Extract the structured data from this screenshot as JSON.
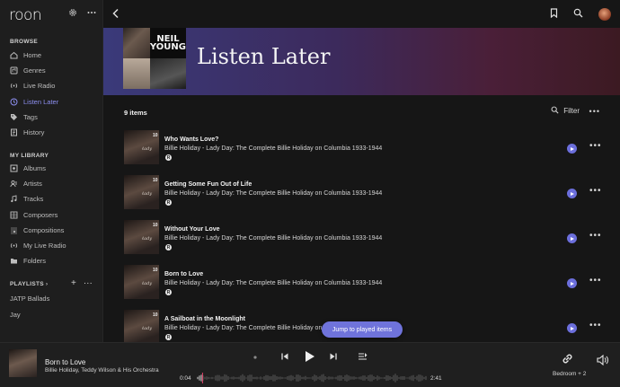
{
  "app": {
    "logo": "roon"
  },
  "sidebar": {
    "browse_title": "BROWSE",
    "browse_items": [
      {
        "label": "Home",
        "icon": "home-icon"
      },
      {
        "label": "Genres",
        "icon": "genres-icon"
      },
      {
        "label": "Live Radio",
        "icon": "radio-icon"
      },
      {
        "label": "Listen Later",
        "icon": "bookmark-icon",
        "active": true
      },
      {
        "label": "Tags",
        "icon": "tag-icon"
      },
      {
        "label": "History",
        "icon": "history-icon"
      }
    ],
    "library_title": "MY LIBRARY",
    "library_items": [
      {
        "label": "Albums",
        "icon": "album-icon"
      },
      {
        "label": "Artists",
        "icon": "artist-icon"
      },
      {
        "label": "Tracks",
        "icon": "track-icon"
      },
      {
        "label": "Composers",
        "icon": "composer-icon"
      },
      {
        "label": "Compositions",
        "icon": "composition-icon"
      },
      {
        "label": "My Live Radio",
        "icon": "radio-icon"
      },
      {
        "label": "Folders",
        "icon": "folder-icon"
      }
    ],
    "playlists_title": "PLAYLISTS",
    "playlists": [
      "JATP Ballads",
      "Jay"
    ]
  },
  "header": {
    "title": "Listen Later",
    "hero_art_text": "NEIL YOUNG"
  },
  "list": {
    "count": "9 items",
    "filter_label": "Filter",
    "tracks": [
      {
        "num": "10",
        "title": "Who Wants Love?",
        "subtitle": "Billie Holiday - Lady Day: The Complete Billie Holiday on Columbia 1933-1944",
        "badge": "R"
      },
      {
        "num": "10",
        "title": "Getting Some Fun Out of Life",
        "subtitle": "Billie Holiday - Lady Day: The Complete Billie Holiday on Columbia 1933-1944",
        "badge": "R"
      },
      {
        "num": "10",
        "title": "Without Your Love",
        "subtitle": "Billie Holiday - Lady Day: The Complete Billie Holiday on Columbia 1933-1944",
        "badge": "R"
      },
      {
        "num": "10",
        "title": "Born to Love",
        "subtitle": "Billie Holiday - Lady Day: The Complete Billie Holiday on Columbia 1933-1944",
        "badge": "R"
      },
      {
        "num": "10",
        "title": "A Sailboat in the Moonlight",
        "subtitle": "Billie Holiday - Lady Day: The Complete Billie Holiday on Columbia 1933-1944",
        "badge": "R"
      }
    ],
    "jump_label": "Jump to played items"
  },
  "player": {
    "title": "Born to Love",
    "artist": "Billie Holiday, Teddy Wilson & His Orchestra",
    "elapsed": "0:04",
    "duration": "2:41",
    "progress": 0.025,
    "zone": "Bedroom + 2"
  },
  "colors": {
    "accent": "#6c6fdc",
    "active_nav": "#8d8ff0"
  }
}
